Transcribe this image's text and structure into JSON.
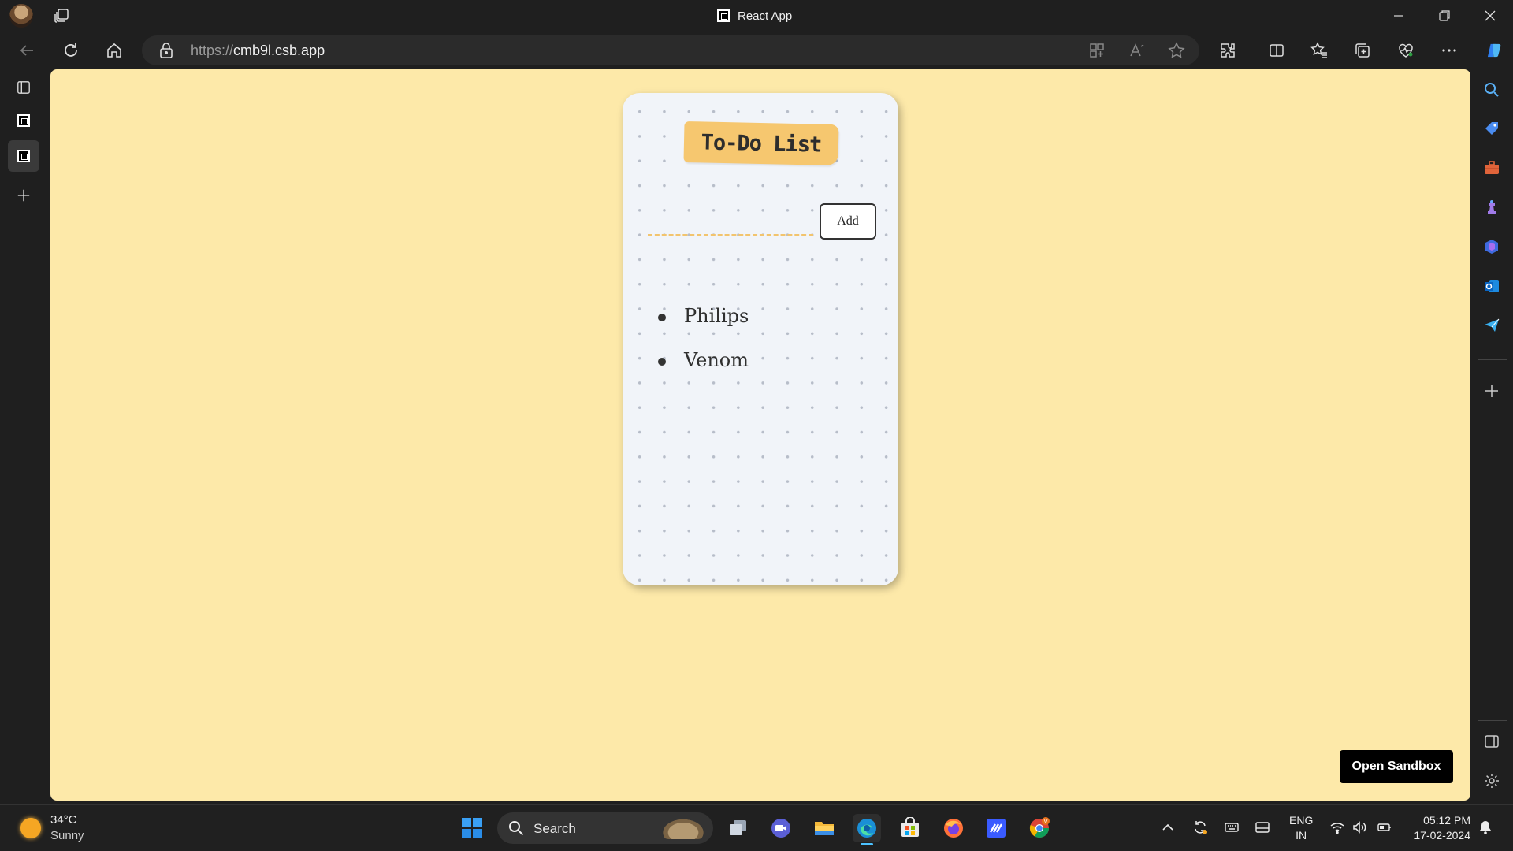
{
  "window": {
    "tab_title": "React App"
  },
  "addressbar": {
    "url_scheme": "https://",
    "url_host": "cmb9l.csb.app"
  },
  "page": {
    "heading": "To-Do List",
    "input_value": "",
    "add_label": "Add",
    "todos": [
      {
        "text": "Philips"
      },
      {
        "text": "Venom"
      }
    ],
    "open_sandbox_label": "Open Sandbox"
  },
  "taskbar": {
    "weather_temp": "34°C",
    "weather_condition": "Sunny",
    "search_label": "Search",
    "lang_primary": "ENG",
    "lang_region": "IN",
    "time": "05:12 PM",
    "date": "17-02-2024",
    "pinned_apps": [
      "windows-start",
      "file-explorer-task-view",
      "zoom",
      "file-explorer",
      "edge",
      "microsoft-store",
      "firefox",
      "visual-studio",
      "chrome"
    ]
  },
  "colors": {
    "page_background": "#fde9a9",
    "card_background": "#f1f4f9",
    "heading_tag": "#f6c76f",
    "input_underline": "#f2c46e",
    "open_sandbox_bg": "#000000",
    "browser_chrome": "#1f1f1f"
  }
}
